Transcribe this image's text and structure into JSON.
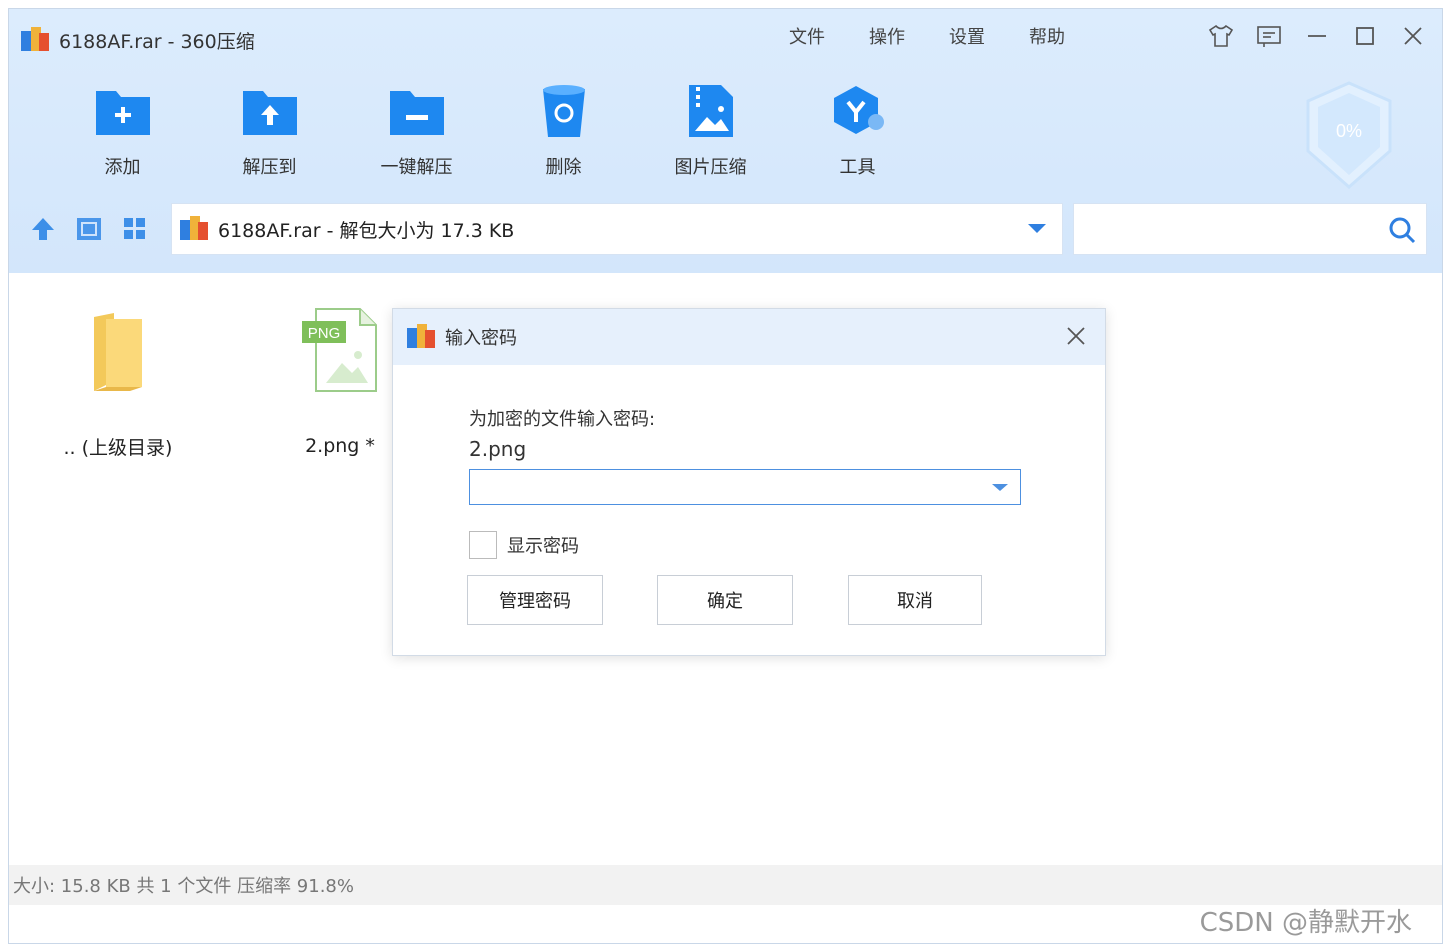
{
  "window": {
    "title": "6188AF.rar - 360压缩"
  },
  "menu": [
    "文件",
    "操作",
    "设置",
    "帮助"
  ],
  "toolbar": [
    {
      "label": "添加",
      "icon": "add-folder-icon"
    },
    {
      "label": "解压到",
      "icon": "extract-to-icon"
    },
    {
      "label": "一键解压",
      "icon": "one-click-extract-icon"
    },
    {
      "label": "删除",
      "icon": "delete-icon"
    },
    {
      "label": "图片压缩",
      "icon": "image-compress-icon"
    },
    {
      "label": "工具",
      "icon": "tools-icon"
    }
  ],
  "shield": {
    "value": "0%"
  },
  "path": {
    "text": "6188AF.rar - 解包大小为 17.3 KB"
  },
  "search": {
    "placeholder": ""
  },
  "files": [
    {
      "name": ".. (上级目录)",
      "icon": "folder-icon"
    },
    {
      "name": "2.png *",
      "icon": "png-file-icon",
      "badge": "PNG"
    }
  ],
  "dialog": {
    "title": "输入密码",
    "prompt": "为加密的文件输入密码:",
    "filename": "2.png",
    "password": "",
    "show_password": "显示密码",
    "buttons": {
      "manage": "管理密码",
      "ok": "确定",
      "cancel": "取消"
    }
  },
  "status": {
    "text": "大小: 15.8 KB 共 1 个文件 压缩率 91.8%"
  },
  "watermark": "CSDN @静默开水",
  "colors": {
    "accent": "#2f7fe0",
    "topbar": "#d8e9fc",
    "dialog_header": "#e6f0fc"
  }
}
